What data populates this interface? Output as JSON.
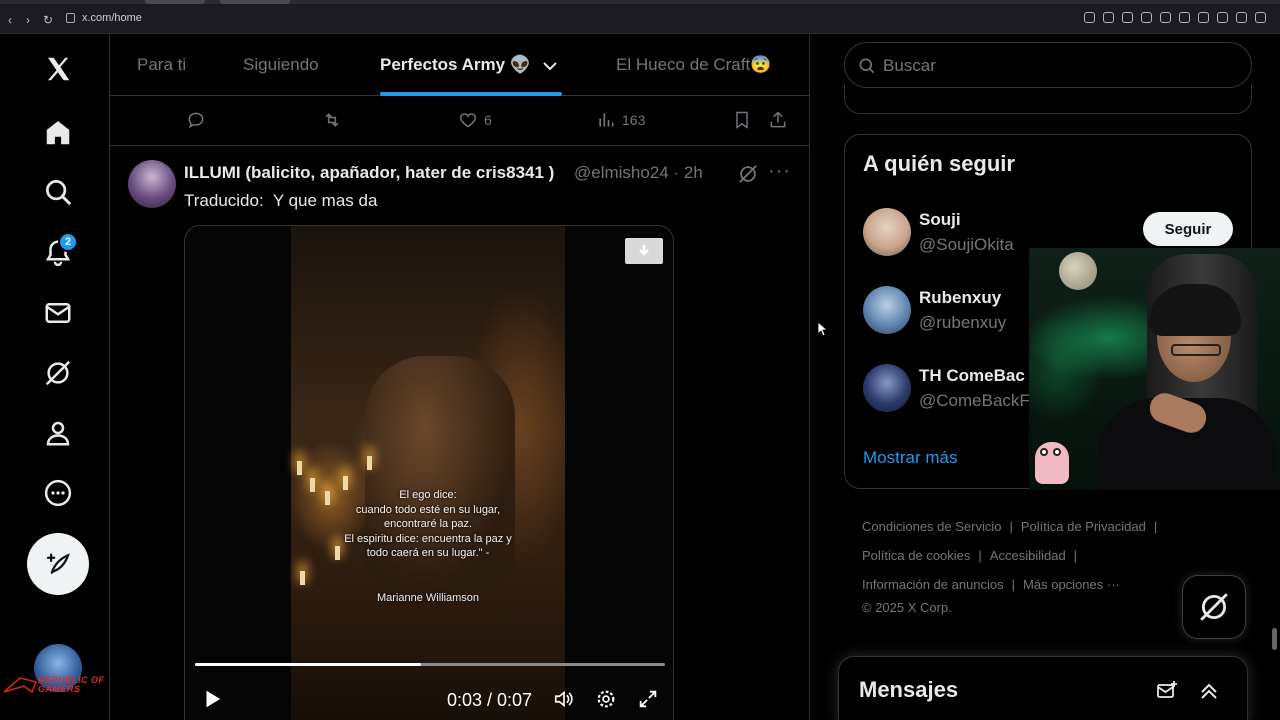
{
  "browser": {
    "url": "x.com/home",
    "nav": {
      "back": "‹",
      "forward": "›",
      "reload": "↻"
    }
  },
  "sidebar": {
    "notification_count": "2",
    "items": [
      {
        "icon": "x-logo-icon"
      },
      {
        "icon": "home-icon"
      },
      {
        "icon": "search-icon"
      },
      {
        "icon": "bell-icon"
      },
      {
        "icon": "mail-icon"
      },
      {
        "icon": "grok-icon"
      },
      {
        "icon": "profile-icon"
      },
      {
        "icon": "more-icon"
      }
    ],
    "post_icon": "compose-icon",
    "brand_overlay": "REPUBLIC OF GAMERS"
  },
  "timeline": {
    "tabs": [
      {
        "label": "Para ti",
        "active": false
      },
      {
        "label": "Siguiendo",
        "active": false
      },
      {
        "label": "Perfectos Army 👽",
        "active": true
      },
      {
        "label": "El Hueco de Craft😨",
        "active": false
      }
    ],
    "prev_actions": {
      "likes": "6",
      "views": "163"
    }
  },
  "tweet": {
    "author": "ILLUMI (balicito, apañador, hater de cris8341 )",
    "handle": "@elmisho24 · 2h",
    "text": "Traducido:  Y que mas da",
    "video": {
      "quote_lines": [
        "El ego dice:",
        "cuando todo esté en su lugar,",
        "encontraré la paz.",
        "El espiritu dice: encuentra la paz y",
        "todo caerá en su lugar.\" -"
      ],
      "author": "Marianne Williamson",
      "time": "0:03 / 0:07",
      "progress": 0.48
    }
  },
  "right": {
    "search_placeholder": "Buscar",
    "who_to_follow": {
      "title": "A quién seguir",
      "users": [
        {
          "name": "Souji",
          "handle": "@SoujiOkita",
          "color": "#c9a58c"
        },
        {
          "name": "Rubenxuy",
          "handle": "@rubenxuy",
          "color": "#5f86b0"
        },
        {
          "name": "TH ComeBac",
          "handle": "@ComeBackF",
          "color": "#2c3a6b"
        }
      ],
      "follow_label": "Seguir",
      "show_more": "Mostrar más"
    },
    "footer": {
      "links": [
        "Condiciones de Servicio",
        "Política de Privacidad",
        "Política de cookies",
        "Accesibilidad",
        "Información de anuncios",
        "Más opciones ···"
      ],
      "copyright": "© 2025 X Corp."
    },
    "messages": {
      "title": "Mensajes"
    }
  },
  "colors": {
    "accent": "#1d9bf0",
    "background": "#000000",
    "muted": "#71767b",
    "border": "#2f3336"
  }
}
